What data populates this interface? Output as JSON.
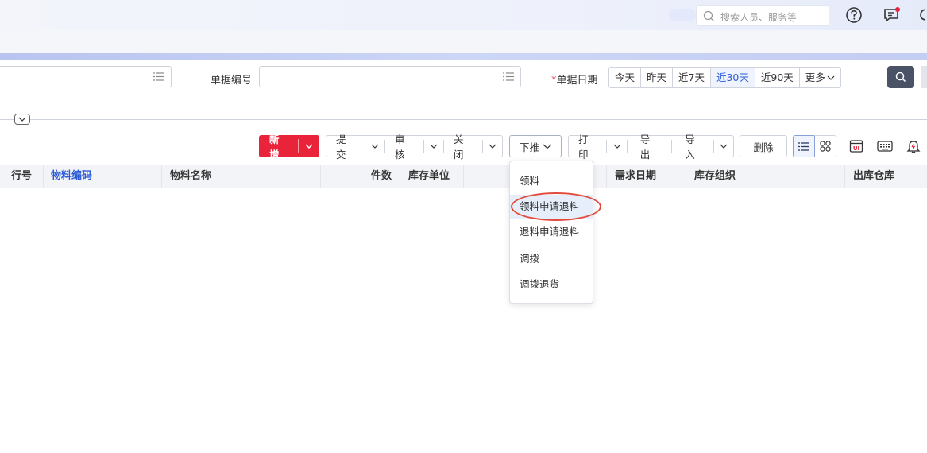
{
  "header": {
    "search_placeholder": "搜索人员、服务等"
  },
  "filters": {
    "doc_number_label": "单据编号",
    "doc_date_label": "单据日期",
    "required_mark": "*",
    "date_ranges": [
      "今天",
      "昨天",
      "近7天",
      "近30天",
      "近90天",
      "更多"
    ],
    "active_range": "近30天"
  },
  "toolbar": {
    "new_label": "新增",
    "submit_label": "提交",
    "audit_label": "审核",
    "close_label": "关闭",
    "push_down_label": "下推",
    "print_label": "打印",
    "export_label": "导出",
    "import_label": "导入",
    "delete_label": "删除"
  },
  "table": {
    "columns": [
      "行号",
      "物料编码",
      "物料名称",
      "件数",
      "库存单位",
      "",
      "需求日期",
      "库存组织",
      "出库仓库"
    ]
  },
  "push_menu": {
    "items": [
      "领料",
      "领料申请退料",
      "退料申请退料",
      "调拨",
      "调拨退货"
    ],
    "highlighted": "领料申请退料"
  },
  "colors": {
    "accent_red": "#e8233a",
    "link_blue": "#2a5bd7",
    "annotation_ring": "#e24b3b"
  }
}
